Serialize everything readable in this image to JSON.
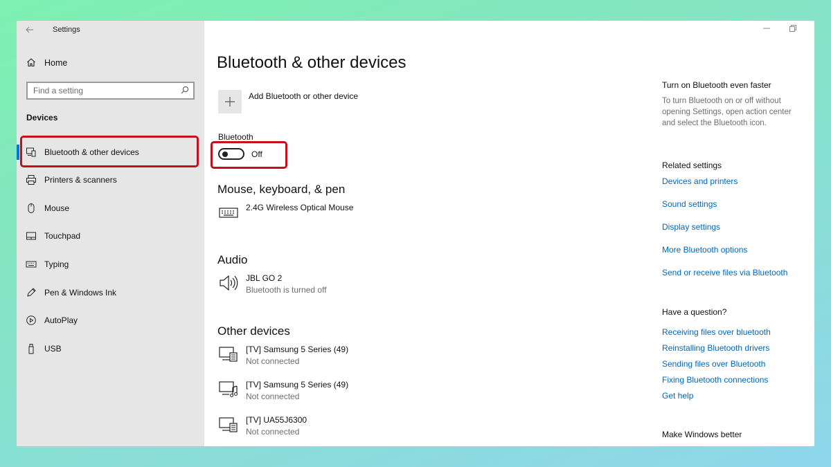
{
  "window": {
    "title": "Settings",
    "back_icon": "back-arrow-icon",
    "controls": [
      "minimize-icon",
      "restore-icon",
      "close-icon"
    ]
  },
  "sidebar": {
    "home_label": "Home",
    "search_placeholder": "Find a setting",
    "section_label": "Devices",
    "items": [
      {
        "label": "Bluetooth & other devices",
        "icon": "bluetooth-devices-icon",
        "active": true
      },
      {
        "label": "Printers & scanners",
        "icon": "printer-icon"
      },
      {
        "label": "Mouse",
        "icon": "mouse-icon"
      },
      {
        "label": "Touchpad",
        "icon": "touchpad-icon"
      },
      {
        "label": "Typing",
        "icon": "keyboard-icon"
      },
      {
        "label": "Pen & Windows Ink",
        "icon": "pen-icon"
      },
      {
        "label": "AutoPlay",
        "icon": "autoplay-icon"
      },
      {
        "label": "USB",
        "icon": "usb-icon"
      }
    ]
  },
  "main": {
    "title": "Bluetooth & other devices",
    "add_label": "Add Bluetooth or other device",
    "bluetooth_label": "Bluetooth",
    "bluetooth_state": "Off",
    "mouse_section": {
      "heading": "Mouse, keyboard, & pen",
      "devices": [
        {
          "name": "2.4G Wireless Optical Mouse",
          "status": ""
        }
      ]
    },
    "audio_section": {
      "heading": "Audio",
      "devices": [
        {
          "name": "JBL GO 2",
          "status": "Bluetooth is turned off"
        }
      ]
    },
    "other_section": {
      "heading": "Other devices",
      "devices": [
        {
          "name": "[TV] Samsung 5 Series (49)",
          "status": "Not connected"
        },
        {
          "name": "[TV] Samsung 5 Series (49)",
          "status": "Not connected"
        },
        {
          "name": "[TV] UA55J6300",
          "status": "Not connected"
        }
      ]
    }
  },
  "right": {
    "faster_heading": "Turn on Bluetooth even faster",
    "faster_text": "To turn Bluetooth on or off without opening Settings, open action center and select the Bluetooth icon.",
    "related_heading": "Related settings",
    "related_links": [
      "Devices and printers",
      "Sound settings",
      "Display settings",
      "More Bluetooth options",
      "Send or receive files via Bluetooth"
    ],
    "question_heading": "Have a question?",
    "question_links": [
      "Receiving files over bluetooth",
      "Reinstalling Bluetooth drivers",
      "Sending files over Bluetooth",
      "Fixing Bluetooth connections",
      "Get help"
    ],
    "better_heading": "Make Windows better"
  },
  "colors": {
    "accent": "#0078d7",
    "link": "#0067b8",
    "highlight": "#c2101e",
    "sidebar_bg": "#e6e6e6"
  }
}
